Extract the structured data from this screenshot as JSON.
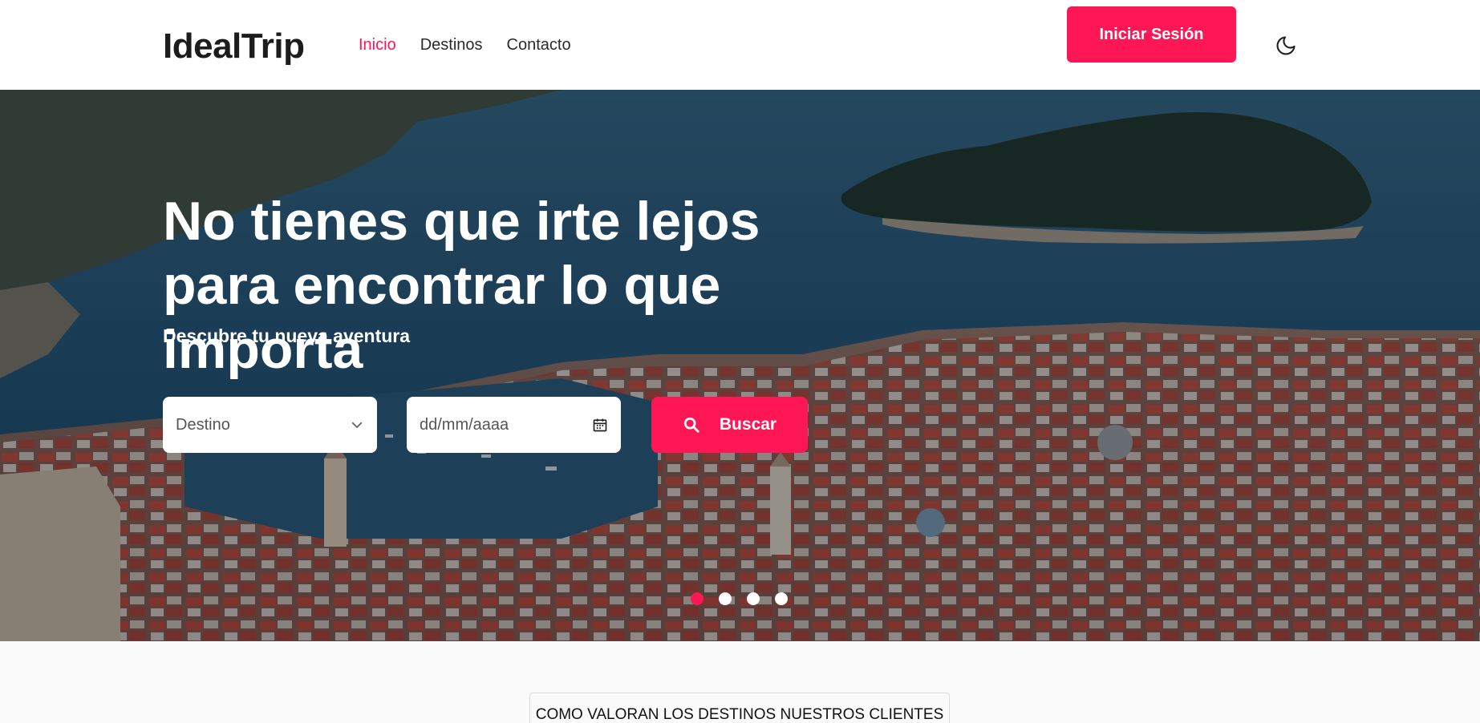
{
  "header": {
    "brand": "IdealTrip",
    "nav": [
      {
        "label": "Inicio",
        "active": true
      },
      {
        "label": "Destinos",
        "active": false
      },
      {
        "label": "Contacto",
        "active": false
      }
    ],
    "login_label": "Iniciar Sesión",
    "theme_icon": "moon-icon"
  },
  "hero": {
    "title": "No tienes que irte lejos para encontrar lo que importa",
    "subtitle": "Descubre tu nueva aventura",
    "destination_select": {
      "value": "Destino",
      "icon": "chevron-down-icon"
    },
    "date_input": {
      "placeholder": "dd/mm/aaaa",
      "icon": "calendar-icon"
    },
    "search_button": {
      "label": "Buscar",
      "icon": "search-icon"
    },
    "carousel": {
      "slides": 4,
      "active_index": 0
    }
  },
  "reviews": {
    "title": "COMO VALORAN LOS DESTINOS NUESTROS CLIENTES"
  },
  "colors": {
    "accent": "#ff1654",
    "header_bg": "#ffffff",
    "page_bg": "#fafafa"
  }
}
